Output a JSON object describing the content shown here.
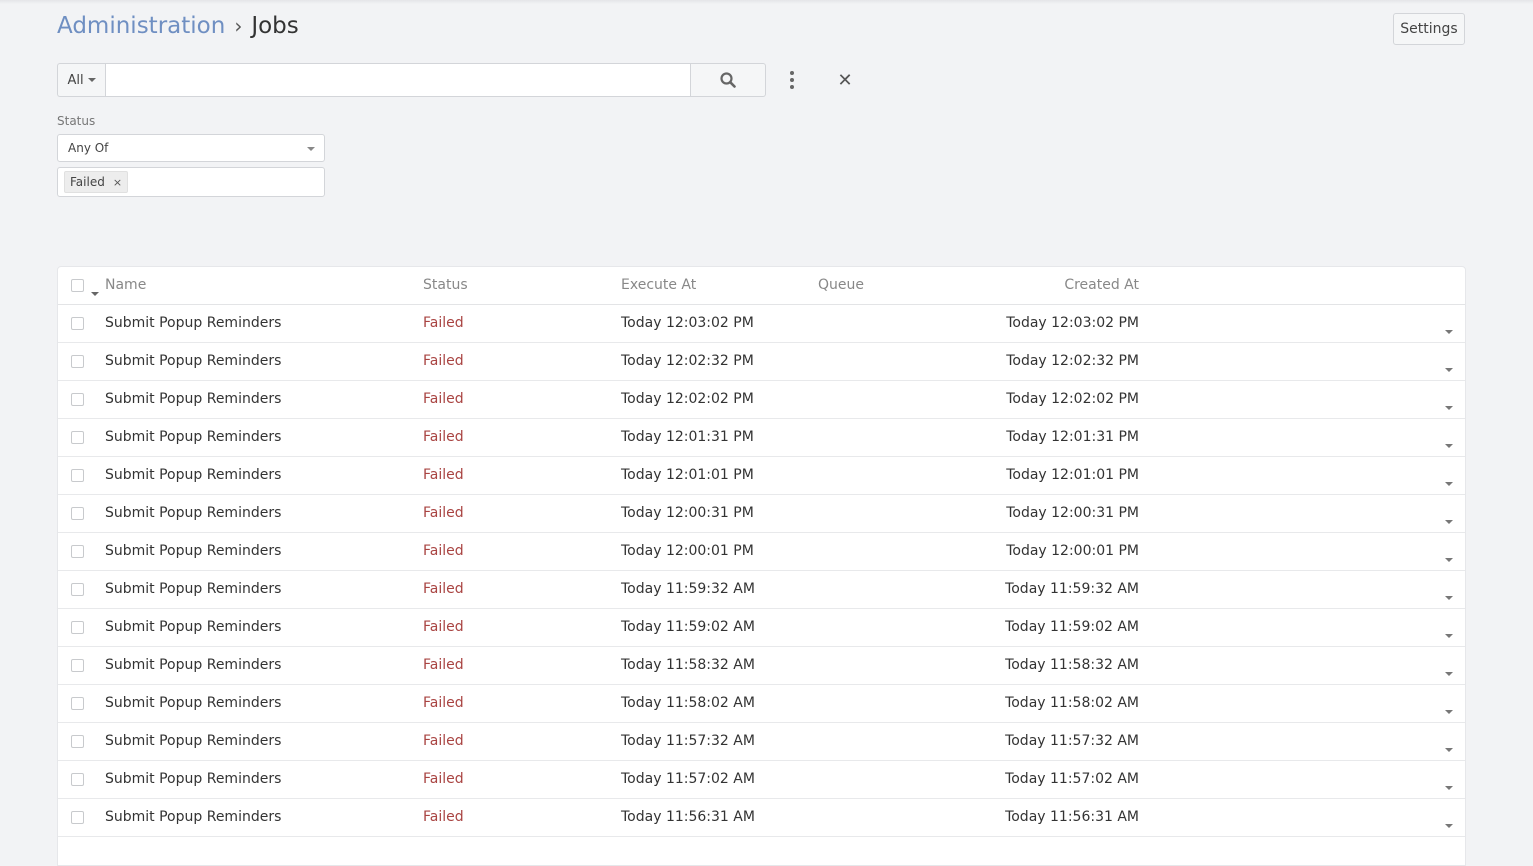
{
  "breadcrumb": {
    "parent": "Administration",
    "separator": "›",
    "current": "Jobs"
  },
  "header": {
    "settings_label": "Settings"
  },
  "search": {
    "scope": "All",
    "value": "",
    "placeholder": ""
  },
  "filters": {
    "status_label": "Status",
    "status_operator": "Any Of",
    "status_values": [
      "Failed"
    ],
    "tag_remove": "×"
  },
  "reset_glyph": "✕",
  "table": {
    "columns": {
      "name": "Name",
      "status": "Status",
      "execute_at": "Execute At",
      "queue": "Queue",
      "created_at": "Created At"
    },
    "rows": [
      {
        "name": "Submit Popup Reminders",
        "status": "Failed",
        "execute_at": "Today 12:03:02 PM",
        "queue": "",
        "created_at": "Today 12:03:02 PM"
      },
      {
        "name": "Submit Popup Reminders",
        "status": "Failed",
        "execute_at": "Today 12:02:32 PM",
        "queue": "",
        "created_at": "Today 12:02:32 PM"
      },
      {
        "name": "Submit Popup Reminders",
        "status": "Failed",
        "execute_at": "Today 12:02:02 PM",
        "queue": "",
        "created_at": "Today 12:02:02 PM"
      },
      {
        "name": "Submit Popup Reminders",
        "status": "Failed",
        "execute_at": "Today 12:01:31 PM",
        "queue": "",
        "created_at": "Today 12:01:31 PM"
      },
      {
        "name": "Submit Popup Reminders",
        "status": "Failed",
        "execute_at": "Today 12:01:01 PM",
        "queue": "",
        "created_at": "Today 12:01:01 PM"
      },
      {
        "name": "Submit Popup Reminders",
        "status": "Failed",
        "execute_at": "Today 12:00:31 PM",
        "queue": "",
        "created_at": "Today 12:00:31 PM"
      },
      {
        "name": "Submit Popup Reminders",
        "status": "Failed",
        "execute_at": "Today 12:00:01 PM",
        "queue": "",
        "created_at": "Today 12:00:01 PM"
      },
      {
        "name": "Submit Popup Reminders",
        "status": "Failed",
        "execute_at": "Today 11:59:32 AM",
        "queue": "",
        "created_at": "Today 11:59:32 AM"
      },
      {
        "name": "Submit Popup Reminders",
        "status": "Failed",
        "execute_at": "Today 11:59:02 AM",
        "queue": "",
        "created_at": "Today 11:59:02 AM"
      },
      {
        "name": "Submit Popup Reminders",
        "status": "Failed",
        "execute_at": "Today 11:58:32 AM",
        "queue": "",
        "created_at": "Today 11:58:32 AM"
      },
      {
        "name": "Submit Popup Reminders",
        "status": "Failed",
        "execute_at": "Today 11:58:02 AM",
        "queue": "",
        "created_at": "Today 11:58:02 AM"
      },
      {
        "name": "Submit Popup Reminders",
        "status": "Failed",
        "execute_at": "Today 11:57:32 AM",
        "queue": "",
        "created_at": "Today 11:57:32 AM"
      },
      {
        "name": "Submit Popup Reminders",
        "status": "Failed",
        "execute_at": "Today 11:57:02 AM",
        "queue": "",
        "created_at": "Today 11:57:02 AM"
      },
      {
        "name": "Submit Popup Reminders",
        "status": "Failed",
        "execute_at": "Today 11:56:31 AM",
        "queue": "",
        "created_at": "Today 11:56:31 AM"
      }
    ]
  },
  "colors": {
    "link": "#6f8fc2",
    "failed": "#a94442",
    "background": "#f2f3f5"
  },
  "icons": {
    "search": "search-icon",
    "more": "kebab-menu-icon",
    "reset": "close-icon",
    "row_menu": "chevron-down-icon"
  }
}
